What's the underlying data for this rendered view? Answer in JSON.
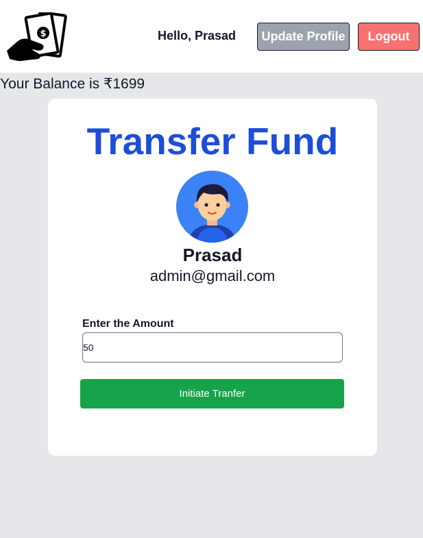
{
  "header": {
    "logo_icon": "cash-hand-icon",
    "greeting": "Hello, Prasad",
    "update_profile_label": "Update Profile",
    "logout_label": "Logout"
  },
  "balance_text": "Your Balance is ₹1699",
  "card": {
    "title": "Transfer Fund",
    "avatar_icon": "user-avatar-icon",
    "name": "Prasad",
    "email": "admin@gmail.com",
    "amount_label": "Enter the Amount",
    "amount_value": "50",
    "transfer_button_label": "Initiate Tranfer"
  },
  "colors": {
    "title_blue": "#1d4ed8",
    "update_button": "#9ca3af",
    "logout_button": "#f87171",
    "transfer_button": "#16a34a",
    "page_background": "#e5e7eb",
    "avatar_background": "#3b82f6"
  }
}
